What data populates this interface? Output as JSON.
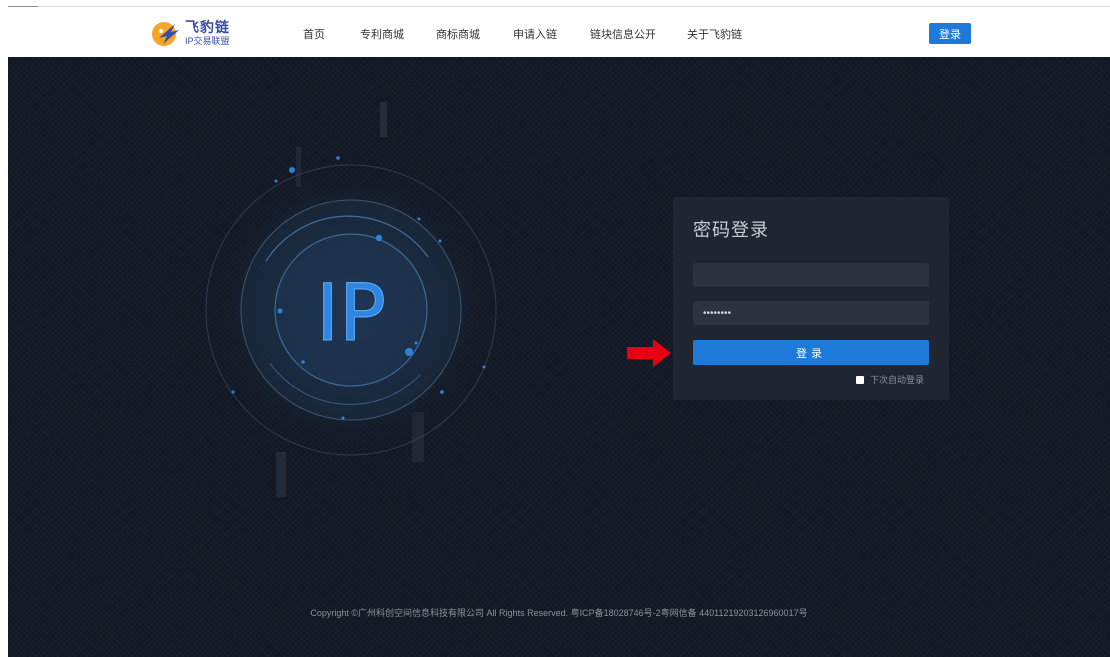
{
  "header": {
    "logo": {
      "title": "飞豹链",
      "subtitle": "IP交易联盟"
    },
    "nav": [
      {
        "label": "首页"
      },
      {
        "label": "专利商城"
      },
      {
        "label": "商标商城"
      },
      {
        "label": "申请入链"
      },
      {
        "label": "链块信息公开"
      },
      {
        "label": "关于飞豹链"
      }
    ],
    "login_button": "登录"
  },
  "hero": {
    "text": "IP"
  },
  "login_card": {
    "title": "密码登录",
    "username_value": "",
    "password_value": "••••••••",
    "submit_label": "登录",
    "remember_label": "下次自动登录",
    "remember_checked": false
  },
  "footer": {
    "text": "Copyright ©广州科创空间信息科技有限公司 All Rights Reserved. 粤ICP备18028746号-2粤网信备 44011219203126960017号"
  },
  "colors": {
    "accent": "#1d7ad8",
    "background": "#121823",
    "card": "#1f2632",
    "arrow": "#e60012"
  },
  "icons": {
    "logo": "leopard-logo-icon",
    "arrow": "red-right-arrow-icon",
    "checkbox": "checkbox-icon"
  }
}
